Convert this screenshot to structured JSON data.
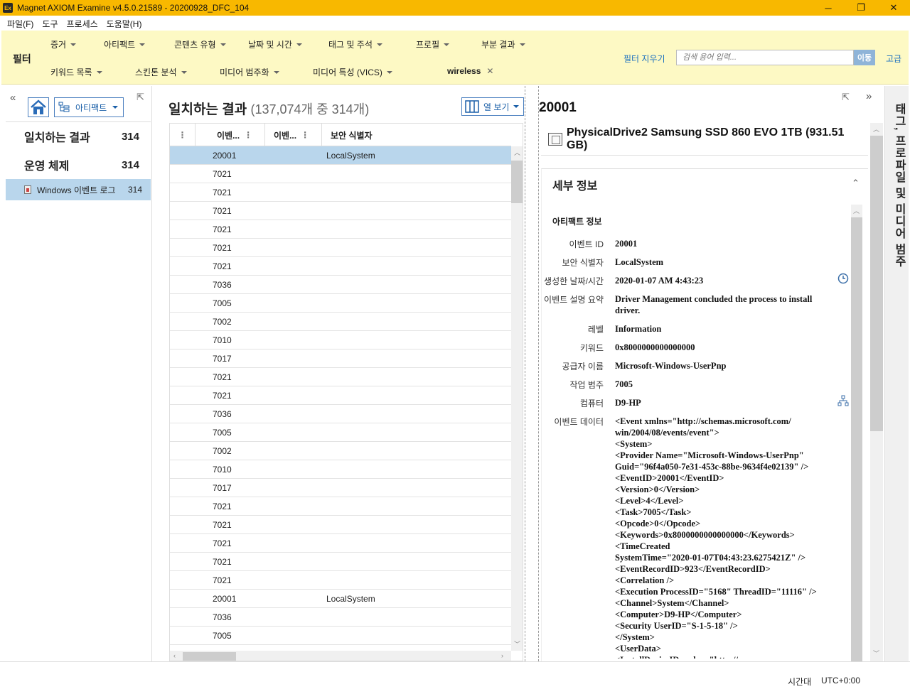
{
  "window": {
    "app_icon": "Ex",
    "title": "Magnet AXIOM Examine v4.5.0.21589 - 20200928_DFC_104",
    "minimize": "─",
    "maximize": "❐",
    "close": "✕"
  },
  "menu": [
    "파일(F)",
    "도구",
    "프로세스",
    "도움말(H)"
  ],
  "filter": {
    "label": "필터",
    "row1": [
      "증거",
      "아티팩트",
      "콘텐츠 유형",
      "날짜 및 시간",
      "태그 및 주석",
      "프로필",
      "부분 결과"
    ],
    "row2": [
      "키워드 목록",
      "스킨톤 분석",
      "미디어 범주화",
      "미디어 특성 (VICS)"
    ],
    "active_keyword": "wireless",
    "clear": "필터 지우기",
    "search_placeholder": "검색 용어 입력...",
    "search_go": "이동",
    "advanced": "고급"
  },
  "left_panel": {
    "view_selector": "아티팩트",
    "categories": [
      {
        "label": "일치하는 결과",
        "count": "314"
      },
      {
        "label": "운영 체제",
        "count": "314"
      }
    ],
    "selected_sub": {
      "label": "Windows 이벤트 로그",
      "count": "314"
    }
  },
  "results": {
    "title": "일치하는 결과",
    "subtitle": "(137,074개 중 314개)",
    "column_view": "열 보기",
    "columns": [
      "이벤...",
      "이벤...",
      "보안 식별자"
    ],
    "rows": [
      {
        "event_id": "20001",
        "sid": "LocalSystem",
        "selected": true
      },
      {
        "event_id": "7021",
        "sid": ""
      },
      {
        "event_id": "7021",
        "sid": ""
      },
      {
        "event_id": "7021",
        "sid": ""
      },
      {
        "event_id": "7021",
        "sid": ""
      },
      {
        "event_id": "7021",
        "sid": ""
      },
      {
        "event_id": "7021",
        "sid": ""
      },
      {
        "event_id": "7036",
        "sid": ""
      },
      {
        "event_id": "7005",
        "sid": ""
      },
      {
        "event_id": "7002",
        "sid": ""
      },
      {
        "event_id": "7010",
        "sid": ""
      },
      {
        "event_id": "7017",
        "sid": ""
      },
      {
        "event_id": "7021",
        "sid": ""
      },
      {
        "event_id": "7021",
        "sid": ""
      },
      {
        "event_id": "7036",
        "sid": ""
      },
      {
        "event_id": "7005",
        "sid": ""
      },
      {
        "event_id": "7002",
        "sid": ""
      },
      {
        "event_id": "7010",
        "sid": ""
      },
      {
        "event_id": "7017",
        "sid": ""
      },
      {
        "event_id": "7021",
        "sid": ""
      },
      {
        "event_id": "7021",
        "sid": ""
      },
      {
        "event_id": "7021",
        "sid": ""
      },
      {
        "event_id": "7021",
        "sid": ""
      },
      {
        "event_id": "7021",
        "sid": ""
      },
      {
        "event_id": "20001",
        "sid": "LocalSystem"
      },
      {
        "event_id": "7036",
        "sid": ""
      },
      {
        "event_id": "7005",
        "sid": ""
      }
    ]
  },
  "details": {
    "title": "20001",
    "device": "PhysicalDrive2 Samsung SSD 860 EVO 1TB (931.51 GB)",
    "section": "세부 정보",
    "artifact_info": "아티팩트 정보",
    "props": [
      {
        "k": "이벤트 ID",
        "v": "20001"
      },
      {
        "k": "보안 식별자",
        "v": "LocalSystem"
      },
      {
        "k": "생성한 날짜/시간",
        "v": "2020-01-07 AM 4:43:23"
      },
      {
        "k": "이벤트 설명 요약",
        "v": "Driver Management concluded the process to install driver."
      },
      {
        "k": "레벨",
        "v": "Information"
      },
      {
        "k": "키워드",
        "v": "0x8000000000000000"
      },
      {
        "k": "공급자 이름",
        "v": "Microsoft-Windows-UserPnp"
      },
      {
        "k": "작업 범주",
        "v": "7005"
      },
      {
        "k": "컴퓨터",
        "v": "D9-HP"
      }
    ],
    "event_data_label": "이벤트 데이터",
    "event_data": "<Event xmlns=\"http://schemas.microsoft.com/\nwin/2004/08/events/event\">\n<System>\n<Provider Name=\"Microsoft-Windows-UserPnp\"\nGuid=\"96f4a050-7e31-453c-88be-9634f4e02139\" />\n<EventID>20001</EventID>\n<Version>0</Version>\n<Level>4</Level>\n<Task>7005</Task>\n<Opcode>0</Opcode>\n<Keywords>0x8000000000000000</Keywords>\n<TimeCreated\nSystemTime=\"2020-01-07T04:43:23.6275421Z\" />\n<EventRecordID>923</EventRecordID>\n<Correlation />\n<Execution ProcessID=\"5168\" ThreadID=\"11116\" />\n<Channel>System</Channel>\n<Computer>D9-HP</Computer>\n<Security UserID=\"S-1-5-18\" />\n</System>\n<UserData>\n<InstallDeviceID xmlns=\"http://"
  },
  "side_tab": "태그, 프로파일 및 미디어 범주",
  "status": {
    "timezone_label": "시간대",
    "timezone_value": "UTC+0:00"
  }
}
